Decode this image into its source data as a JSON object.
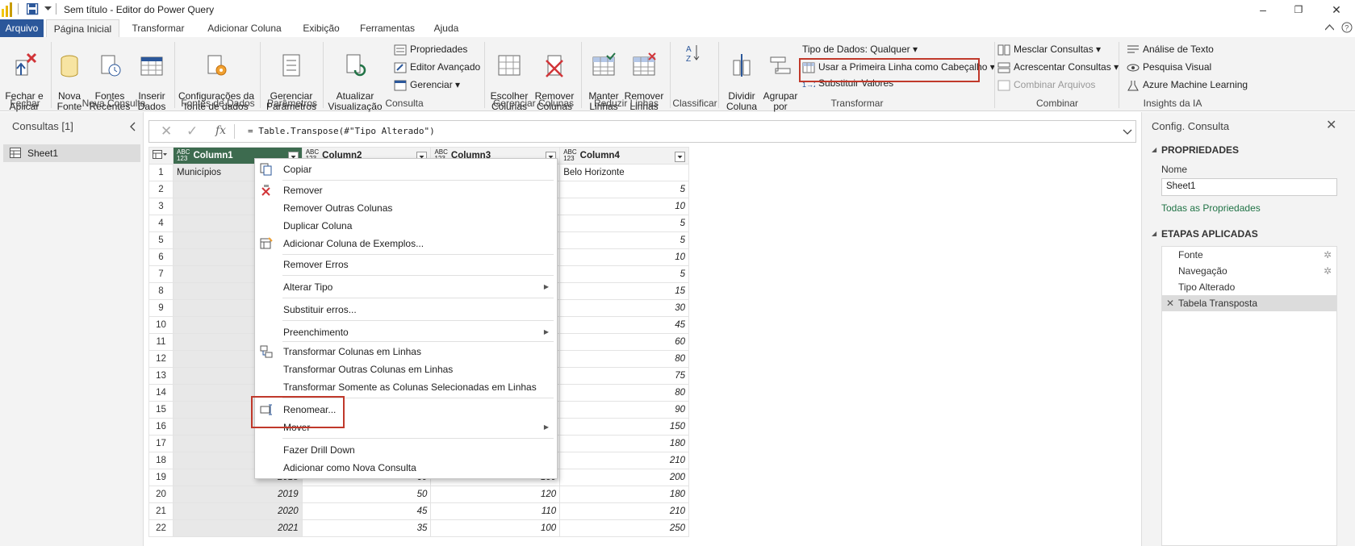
{
  "window": {
    "title": "Sem título - Editor do Power Query",
    "controls": {
      "minimize": "–",
      "maximize": "❐",
      "close": "✕"
    }
  },
  "tabs": [
    "Arquivo",
    "Página Inicial",
    "Transformar",
    "Adicionar Coluna",
    "Exibição",
    "Ferramentas",
    "Ajuda"
  ],
  "ribbon": {
    "fechar_aplicar": "Fechar e\nAplicar",
    "nova_fonte": "Nova\nFonte",
    "fontes_recentes": "Fontes\nRecentes",
    "inserir_dados": "Inserir\nDados",
    "config_fonte": "Configurações da\nfonte de dados",
    "gerenciar_parametros": "Gerenciar\nParâmetros",
    "atualizar": "Atualizar\nVisualização",
    "propriedades": "Propriedades",
    "editor_avancado": "Editor Avançado",
    "gerenciar": "Gerenciar",
    "escolher_colunas": "Escolher\nColunas",
    "remover_colunas": "Remover\nColunas",
    "manter_linhas": "Manter\nLinhas",
    "remover_linhas": "Remover\nLinhas",
    "dividir_coluna": "Dividir\nColuna",
    "agrupar_por": "Agrupar\npor",
    "tipo_dados": "Tipo de Dados: Qualquer",
    "primeira_linha": "Usar a Primeira Linha como Cabeçalho",
    "substituir": "Substituir Valores",
    "mesclar": "Mesclar Consultas",
    "acrescentar": "Acrescentar Consultas",
    "combinar_arquivos": "Combinar Arquivos",
    "analise_texto": "Análise de Texto",
    "pesquisa_visual": "Pesquisa Visual",
    "azure_ml": "Azure Machine Learning",
    "groups": [
      "Fechar",
      "Nova Consulta",
      "Fontes de Dados",
      "Parâmetros",
      "Consulta",
      "Gerenciar Colunas",
      "Reduzir Linhas",
      "Classificar",
      "Transformar",
      "Combinar",
      "Insights da IA"
    ]
  },
  "left_pane": {
    "title": "Consultas [1]",
    "query": "Sheet1"
  },
  "formula": {
    "text": "= Table.Transpose(#\"Tipo Alterado\")",
    "fx": "fx"
  },
  "grid": {
    "columns": [
      "Column1",
      "Column2",
      "Column3",
      "Column4"
    ],
    "type_tag": "ABC\n123",
    "rows": [
      [
        "1",
        "Municípios",
        "",
        "",
        "Belo Horizonte"
      ],
      [
        "2",
        "",
        "",
        "",
        "5"
      ],
      [
        "3",
        "",
        "",
        "",
        "10"
      ],
      [
        "4",
        "",
        "",
        "",
        "5"
      ],
      [
        "5",
        "",
        "",
        "",
        "5"
      ],
      [
        "6",
        "",
        "",
        "",
        "10"
      ],
      [
        "7",
        "",
        "",
        "",
        "5"
      ],
      [
        "8",
        "",
        "",
        "",
        "15"
      ],
      [
        "9",
        "",
        "",
        "",
        "30"
      ],
      [
        "10",
        "",
        "",
        "",
        "45"
      ],
      [
        "11",
        "",
        "",
        "",
        "60"
      ],
      [
        "12",
        "",
        "",
        "",
        "80"
      ],
      [
        "13",
        "",
        "",
        "",
        "75"
      ],
      [
        "14",
        "",
        "",
        "",
        "80"
      ],
      [
        "15",
        "",
        "",
        "",
        "90"
      ],
      [
        "16",
        "",
        "",
        "",
        "150"
      ],
      [
        "17",
        "",
        "",
        "",
        "180"
      ],
      [
        "18",
        "",
        "",
        "",
        "210"
      ],
      [
        "19",
        "2018",
        "60",
        "130",
        "200"
      ],
      [
        "20",
        "2019",
        "50",
        "120",
        "180"
      ],
      [
        "21",
        "2020",
        "45",
        "110",
        "210"
      ],
      [
        "22",
        "2021",
        "35",
        "100",
        "250"
      ]
    ]
  },
  "context_menu": {
    "items": [
      "Copiar",
      "Remover",
      "Remover Outras Colunas",
      "Duplicar Coluna",
      "Adicionar Coluna de Exemplos...",
      "Remover Erros",
      "Alterar Tipo",
      "Substituir erros...",
      "Preenchimento",
      "Transformar Colunas em Linhas",
      "Transformar Outras Colunas em Linhas",
      "Transformar Somente as Colunas Selecionadas em Linhas",
      "Renomear...",
      "Mover",
      "Fazer Drill Down",
      "Adicionar como Nova Consulta"
    ]
  },
  "right_pane": {
    "title": "Config. Consulta",
    "properties_header": "PROPRIEDADES",
    "name_label": "Nome",
    "name_value": "Sheet1",
    "all_props": "Todas as Propriedades",
    "steps_header": "ETAPAS APLICADAS",
    "steps": [
      "Fonte",
      "Navegação",
      "Tipo Alterado",
      "Tabela Transposta"
    ]
  },
  "colors": {
    "file_tab": "#2b579a",
    "selected_header": "#3d6b4f",
    "highlight": "#c0392b",
    "accent_link": "#217346"
  }
}
